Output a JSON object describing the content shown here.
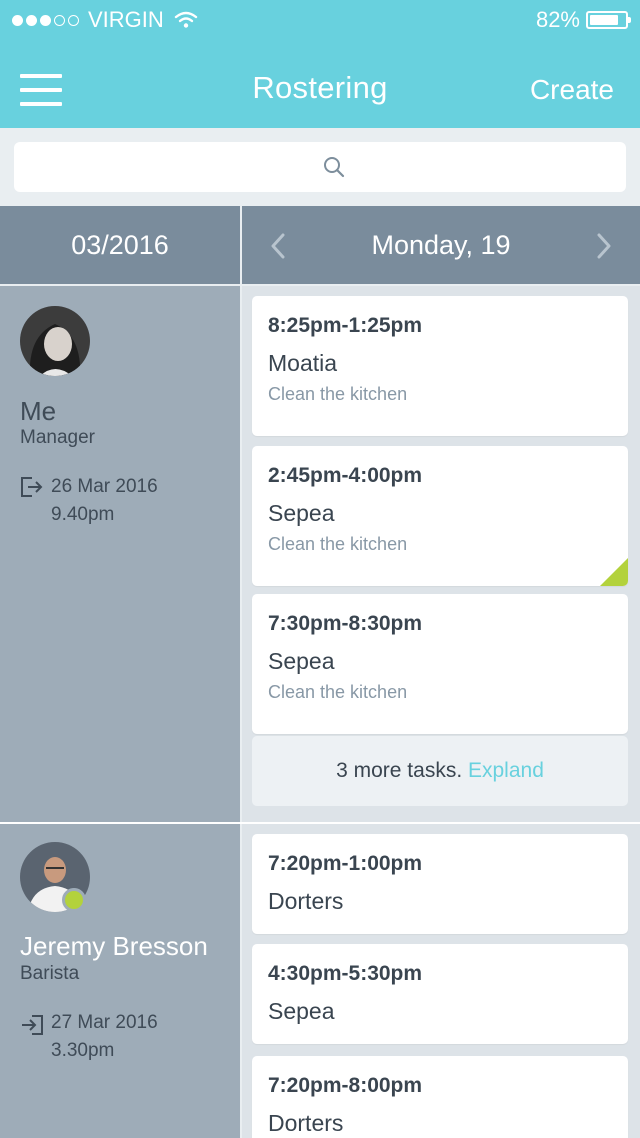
{
  "status_bar": {
    "signal_dots": 5,
    "signal_filled": 3,
    "carrier": "VIRGIN",
    "battery": "82%",
    "battery_level": 0.82
  },
  "nav": {
    "title": "Rostering",
    "create_label": "Create"
  },
  "search": {
    "placeholder": ""
  },
  "date_bar": {
    "month": "03/2016",
    "day": "Monday, 19"
  },
  "people": [
    {
      "name": "Me",
      "role": "Manager",
      "date": "26 Mar 2016",
      "time": "9.40pm",
      "icon": "sign-out-icon",
      "online": false,
      "tasks": [
        {
          "time": "8:25pm-1:25pm",
          "location": "Moatia",
          "description": "Clean the kitchen",
          "flagged": false
        },
        {
          "time": "2:45pm-4:00pm",
          "location": "Sepea",
          "description": "Clean the kitchen",
          "flagged": true
        },
        {
          "time": "7:30pm-8:30pm",
          "location": "Sepea",
          "description": "Clean the kitchen",
          "flagged": false
        }
      ],
      "more": {
        "text": "3 more tasks.",
        "link": "Expland"
      }
    },
    {
      "name": "Jeremy Bresson",
      "role": "Barista",
      "date": "27 Mar 2016",
      "time": "3.30pm",
      "icon": "sign-in-icon",
      "online": true,
      "tasks": [
        {
          "time": "7:20pm-1:00pm",
          "location": "Dorters"
        },
        {
          "time": "4:30pm-5:30pm",
          "location": "Sepea"
        },
        {
          "time": "7:20pm-8:00pm",
          "location": "Dorters"
        }
      ]
    }
  ],
  "colors": {
    "accent": "#68d1de",
    "header_bar": "#7a8c9c",
    "sidebar": "#9eacb8",
    "flag": "#b3d23c"
  }
}
